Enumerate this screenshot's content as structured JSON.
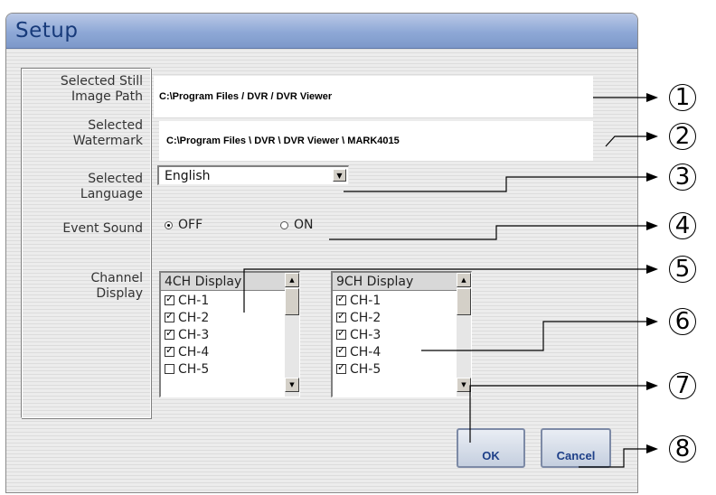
{
  "dialog": {
    "title": "Setup"
  },
  "labels": {
    "still_path": [
      "Selected Still",
      "Image Path"
    ],
    "watermark": [
      "Selected",
      "Watermark"
    ],
    "language": [
      "Selected",
      "Language"
    ],
    "event_sound": "Event Sound",
    "channel_display": [
      "Channel",
      "Display"
    ]
  },
  "fields": {
    "still_image_path": "C:\\Program Files / DVR / DVR Viewer",
    "watermark_path": "C:\\Program Files \\ DVR \\ DVR Viewer \\ MARK4015",
    "language": "English"
  },
  "event_sound": {
    "off_label": "OFF",
    "on_label": "ON",
    "selected": "OFF"
  },
  "lists": {
    "ch4": {
      "header": "4CH Display",
      "items": [
        {
          "label": "CH-1",
          "checked": true
        },
        {
          "label": "CH-2",
          "checked": true
        },
        {
          "label": "CH-3",
          "checked": true
        },
        {
          "label": "CH-4",
          "checked": true
        },
        {
          "label": "CH-5",
          "checked": false
        }
      ]
    },
    "ch9": {
      "header": "9CH Display",
      "items": [
        {
          "label": "CH-1",
          "checked": true
        },
        {
          "label": "CH-2",
          "checked": true
        },
        {
          "label": "CH-3",
          "checked": true
        },
        {
          "label": "CH-4",
          "checked": true
        },
        {
          "label": "CH-5",
          "checked": true
        }
      ]
    }
  },
  "buttons": {
    "ok": "OK",
    "cancel": "Cancel"
  },
  "callouts": [
    "①",
    "②",
    "③",
    "④",
    "⑤",
    "⑥",
    "⑦",
    "⑧"
  ],
  "colors": {
    "title_bar": "#8ea8d6",
    "title_text": "#173a7a",
    "button_text": "#1e3f88"
  }
}
